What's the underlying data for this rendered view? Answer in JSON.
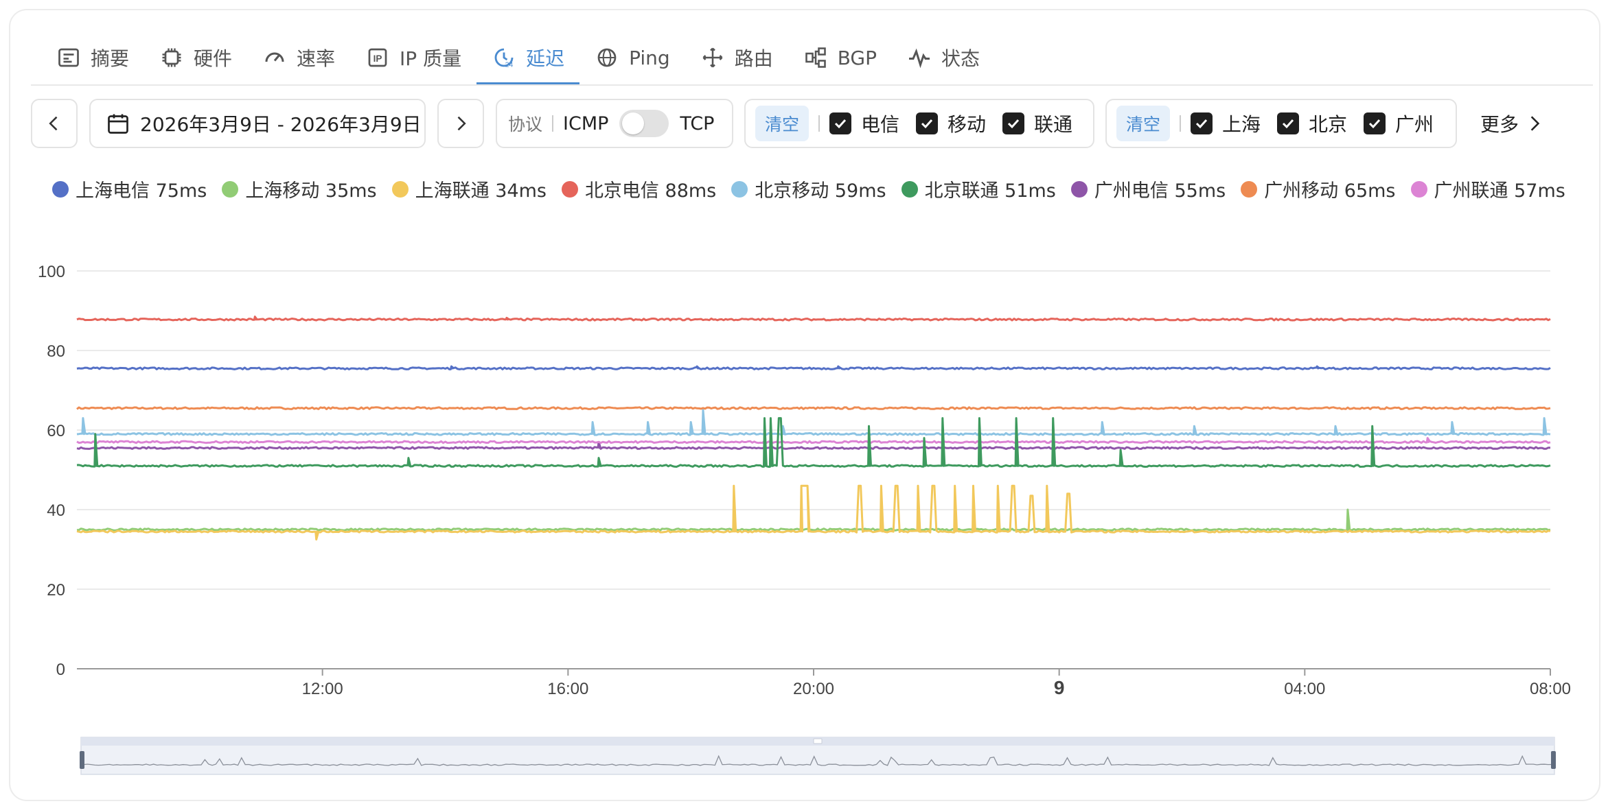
{
  "tabs": [
    {
      "label": "摘要",
      "icon": "summary-icon",
      "active": false
    },
    {
      "label": "硬件",
      "icon": "chip-icon",
      "active": false
    },
    {
      "label": "速率",
      "icon": "gauge-icon",
      "active": false
    },
    {
      "label": "IP 质量",
      "icon": "ip-icon",
      "active": false
    },
    {
      "label": "延迟",
      "icon": "latency-clock-icon",
      "active": true
    },
    {
      "label": "Ping",
      "icon": "globe-icon",
      "active": false
    },
    {
      "label": "路由",
      "icon": "route-icon",
      "active": false
    },
    {
      "label": "BGP",
      "icon": "bgp-icon",
      "active": false
    },
    {
      "label": "状态",
      "icon": "pulse-icon",
      "active": false
    }
  ],
  "toolbar": {
    "date_range": "2026年3月9日 - 2026年3月9日",
    "protocol_label": "协议",
    "protocol_left": "ICMP",
    "protocol_right": "TCP",
    "clear_label": "清空",
    "isps": [
      "电信",
      "移动",
      "联通"
    ],
    "cities": [
      "上海",
      "北京",
      "广州"
    ],
    "more_label": "更多"
  },
  "colors": {
    "accent": "#4a8bd0",
    "上海电信": "#5470c6",
    "上海移动": "#91cc75",
    "上海联通": "#f2c85b",
    "北京电信": "#e5645a",
    "北京移动": "#8cc3e3",
    "北京联通": "#3e9a5e",
    "广州电信": "#8e55a8",
    "广州移动": "#ee8b52",
    "广州联通": "#dc84d4"
  },
  "legend": [
    "上海电信 75ms",
    "上海移动 35ms",
    "上海联通 34ms",
    "北京电信 88ms",
    "北京移动 59ms",
    "北京联通 51ms",
    "广州电信 55ms",
    "广州移动 65ms",
    "广州联通 57ms"
  ],
  "chart_data": {
    "type": "line",
    "x_ticks": [
      "12:00",
      "16:00",
      "20:00",
      "9",
      "04:00",
      "08:00"
    ],
    "x_hours_of_ticks": [
      12,
      16,
      20,
      24,
      28,
      32
    ],
    "x_range_hours": [
      8,
      32
    ],
    "ylim": [
      0,
      100
    ],
    "y_ticks": [
      0,
      20,
      40,
      60,
      80,
      100
    ],
    "grid": true,
    "legend_position": "top",
    "series": [
      {
        "name": "上海电信",
        "base": 75.5,
        "spikes": [
          [
            14.1,
            76
          ],
          [
            18.1,
            76
          ],
          [
            20.4,
            76
          ],
          [
            28.2,
            76
          ]
        ]
      },
      {
        "name": "上海移动",
        "base": 35,
        "spikes": [
          [
            28.7,
            40
          ]
        ]
      },
      {
        "name": "上海联通",
        "base": 34.5,
        "dips": [
          [
            11.9,
            32.5
          ]
        ],
        "spikes": [
          [
            18.7,
            46
          ],
          [
            19.8,
            46
          ],
          [
            19.85,
            46
          ],
          [
            19.9,
            46
          ],
          [
            20.75,
            46
          ],
          [
            21.1,
            46
          ],
          [
            21.35,
            46
          ],
          [
            21.7,
            46
          ],
          [
            21.95,
            46
          ],
          [
            22.3,
            46
          ],
          [
            22.6,
            46
          ],
          [
            23.0,
            46
          ],
          [
            23.25,
            46
          ],
          [
            23.55,
            43.5
          ],
          [
            23.8,
            46
          ],
          [
            24.15,
            44
          ]
        ]
      },
      {
        "name": "北京电信",
        "base": 87.8,
        "spikes": [
          [
            10.9,
            88.5
          ],
          [
            15.0,
            88.2
          ]
        ]
      },
      {
        "name": "北京移动",
        "base": 59,
        "spikes": [
          [
            8.1,
            63
          ],
          [
            16.4,
            62
          ],
          [
            17.3,
            62
          ],
          [
            18.0,
            62
          ],
          [
            18.2,
            65
          ],
          [
            19.5,
            61
          ],
          [
            24.7,
            62
          ],
          [
            26.2,
            61
          ],
          [
            28.5,
            61
          ],
          [
            30.4,
            62
          ],
          [
            31.9,
            63
          ]
        ]
      },
      {
        "name": "北京联通",
        "base": 51,
        "spikes": [
          [
            8.3,
            59
          ],
          [
            13.4,
            53
          ],
          [
            16.5,
            53
          ],
          [
            19.2,
            63
          ],
          [
            19.3,
            63
          ],
          [
            19.45,
            63
          ],
          [
            20.9,
            61
          ],
          [
            21.8,
            58
          ],
          [
            22.1,
            63
          ],
          [
            22.7,
            63
          ],
          [
            23.3,
            63
          ],
          [
            23.9,
            63
          ],
          [
            25.0,
            55
          ],
          [
            29.1,
            61
          ]
        ]
      },
      {
        "name": "广州电信",
        "base": 55.5,
        "spikes": [
          [
            16.5,
            57
          ]
        ]
      },
      {
        "name": "广州移动",
        "base": 65.5,
        "spikes": []
      },
      {
        "name": "广州联通",
        "base": 57,
        "spikes": [
          [
            30.0,
            58
          ]
        ]
      }
    ]
  }
}
